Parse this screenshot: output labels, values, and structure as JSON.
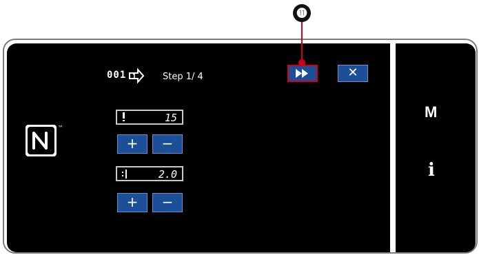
{
  "callout": {
    "number": "⓫"
  },
  "header": {
    "pattern_number": "001",
    "step_text": "Step  1/ 4"
  },
  "params": [
    {
      "icon": "stitch-count-icon",
      "value": "15"
    },
    {
      "icon": "stitch-length-icon",
      "value": "2.0"
    }
  ],
  "buttons": {
    "plus_label": "+",
    "minus_label": "−",
    "close_label": "✕"
  },
  "side": {
    "mode_label": "M",
    "info_label": "i"
  },
  "colors": {
    "button_blue": "#1d4f98",
    "highlight_red": "#d0021b"
  }
}
